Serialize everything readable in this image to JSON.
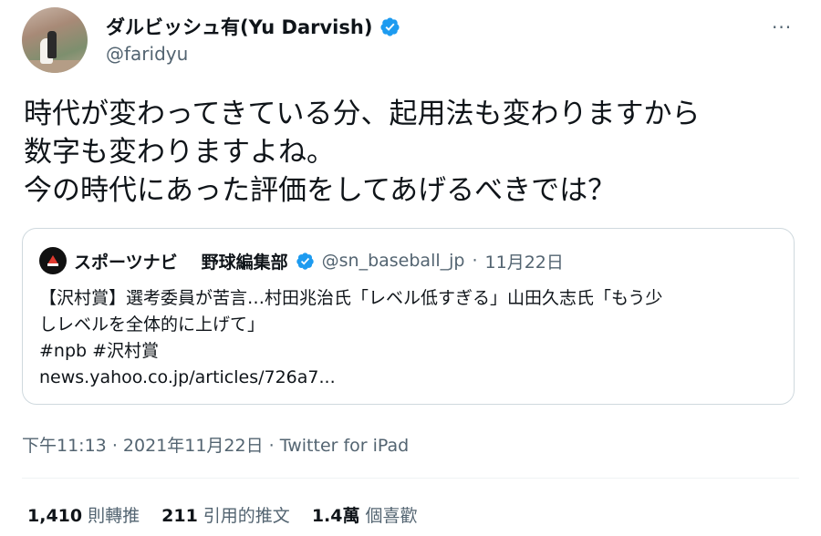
{
  "author": {
    "display_name": "ダルビッシュ有(Yu Darvish)",
    "handle": "@faridyu",
    "avatar_icon": "avatar-photo",
    "verified_color": "#1d9bf0"
  },
  "tweet": {
    "lines": [
      "時代が変わってきている分、起用法も変わりますから",
      "数字も変わりますよね。",
      "今の時代にあった評価をしてあげるべきでは？"
    ]
  },
  "quote": {
    "brand": "スポーツナビ",
    "account_name": "野球編集部",
    "handle": "@sn_baseball_jp",
    "separator": "·",
    "date": "11月22日",
    "body_lines": [
      "【沢村賞】選考委員が苦言…村田兆治氏「レベル低すぎる」山田久志氏「もう少",
      "しレベルを全体的に上げて」",
      "#npb #沢村賞"
    ],
    "link": "news.yahoo.co.jp/articles/726a7..."
  },
  "meta": {
    "time": "下午11:13",
    "date": "2021年11月22日",
    "source": "Twitter for iPad",
    "sep": "·"
  },
  "stats": {
    "retweets_count": "1,410",
    "retweets_label": "則轉推",
    "quotes_count": "211",
    "quotes_label": "引用的推文",
    "likes_count": "1.4萬",
    "likes_label": "個喜歡"
  },
  "more_label": "···"
}
